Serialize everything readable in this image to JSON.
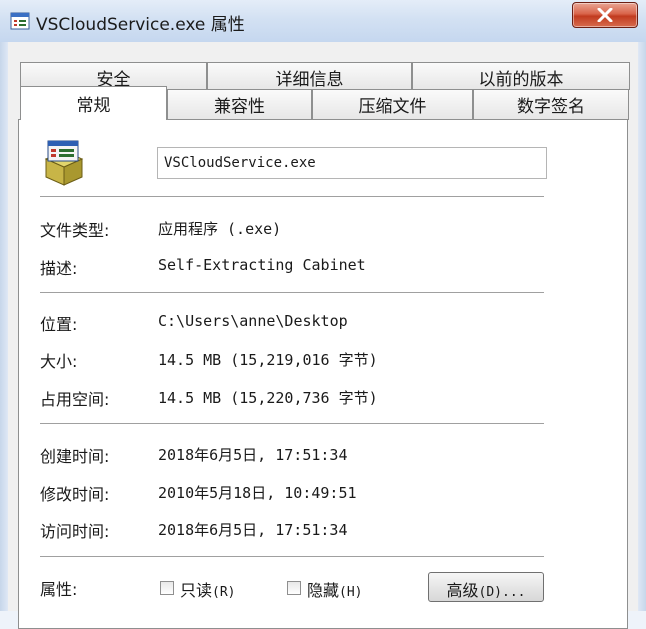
{
  "window": {
    "title": "VSCloudService.exe 属性",
    "close_label": "x"
  },
  "tabs": {
    "back_row": [
      "安全",
      "详细信息",
      "以前的版本"
    ],
    "front_row": [
      "常规",
      "兼容性",
      "压缩文件",
      "数字签名"
    ],
    "active": "常规"
  },
  "general": {
    "filename": "VSCloudService.exe",
    "type_label": "文件类型:",
    "type_value": "应用程序 (.exe)",
    "desc_label": "描述:",
    "desc_value": "Self-Extracting Cabinet",
    "location_label": "位置:",
    "location_value": "C:\\Users\\anne\\Desktop",
    "size_label": "大小:",
    "size_value": "14.5 MB (15,219,016 字节)",
    "disk_label": "占用空间:",
    "disk_value": "14.5 MB (15,220,736 字节)",
    "created_label": "创建时间:",
    "created_value": "2018年6月5日, 17:51:34",
    "modified_label": "修改时间:",
    "modified_value": "2010年5月18日, 10:49:51",
    "accessed_label": "访问时间:",
    "accessed_value": "2018年6月5日, 17:51:34",
    "attr_label": "属性:",
    "readonly_label": "只读",
    "readonly_accel": "(R)",
    "hidden_label": "隐藏",
    "hidden_accel": "(H)",
    "advanced_label": "高级",
    "advanced_accel": "(D)..."
  },
  "colors": {
    "close_button": "#c9472b",
    "title_bar": "#d3e1f3",
    "panel": "#ffffff"
  }
}
